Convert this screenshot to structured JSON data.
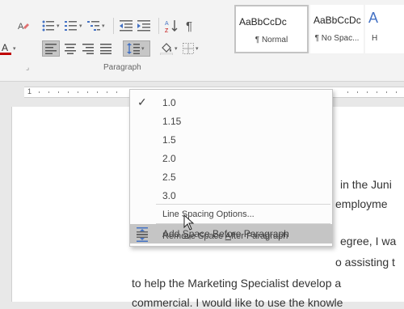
{
  "ribbon": {
    "group_label": "Paragraph",
    "styles": [
      {
        "sample": "AaBbCcDc",
        "name": "¶ Normal"
      },
      {
        "sample": "AaBbCcDc",
        "name": "¶ No Spac..."
      },
      {
        "sample": "A",
        "name": "H"
      }
    ],
    "show_formatting_glyph": "¶",
    "sort_glyph": "A↓Z",
    "font_color_letter": "A",
    "accent_color": "#c00000"
  },
  "ruler": {
    "marks": [
      "1",
      "1"
    ]
  },
  "menu": {
    "items": [
      {
        "label": "1.0",
        "checked": true
      },
      {
        "label": "1.15"
      },
      {
        "label": "1.5"
      },
      {
        "label": "2.0"
      },
      {
        "label": "2.5"
      },
      {
        "label": "3.0"
      }
    ],
    "options_label": "Line Spacing Options...",
    "add_before_pre": "Add ",
    "add_before_u": "S",
    "add_before_post": "pace Before Paragraph",
    "remove_after_pre": "Remove Space ",
    "remove_after_u": "A",
    "remove_after_post": "fter Paragraph"
  },
  "document": {
    "lines": [
      "in the Juni",
      "employme",
      "egree, I wa",
      "o assisting t",
      "to help the Marketing Specialist develop a",
      "commercial. I would like to use the knowle"
    ]
  }
}
